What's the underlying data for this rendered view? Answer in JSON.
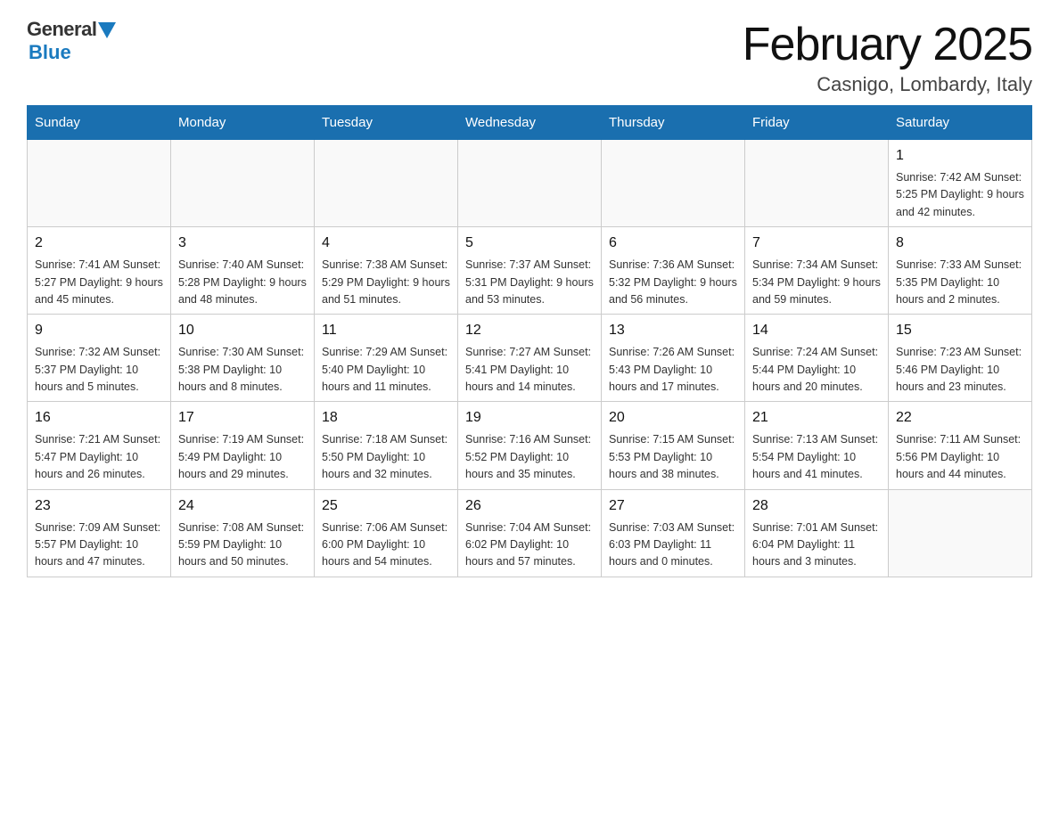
{
  "header": {
    "logo": {
      "general": "General",
      "blue": "Blue"
    },
    "title": "February 2025",
    "location": "Casnigo, Lombardy, Italy"
  },
  "days_of_week": [
    "Sunday",
    "Monday",
    "Tuesday",
    "Wednesday",
    "Thursday",
    "Friday",
    "Saturday"
  ],
  "weeks": [
    [
      {
        "day": "",
        "info": ""
      },
      {
        "day": "",
        "info": ""
      },
      {
        "day": "",
        "info": ""
      },
      {
        "day": "",
        "info": ""
      },
      {
        "day": "",
        "info": ""
      },
      {
        "day": "",
        "info": ""
      },
      {
        "day": "1",
        "info": "Sunrise: 7:42 AM\nSunset: 5:25 PM\nDaylight: 9 hours\nand 42 minutes."
      }
    ],
    [
      {
        "day": "2",
        "info": "Sunrise: 7:41 AM\nSunset: 5:27 PM\nDaylight: 9 hours\nand 45 minutes."
      },
      {
        "day": "3",
        "info": "Sunrise: 7:40 AM\nSunset: 5:28 PM\nDaylight: 9 hours\nand 48 minutes."
      },
      {
        "day": "4",
        "info": "Sunrise: 7:38 AM\nSunset: 5:29 PM\nDaylight: 9 hours\nand 51 minutes."
      },
      {
        "day": "5",
        "info": "Sunrise: 7:37 AM\nSunset: 5:31 PM\nDaylight: 9 hours\nand 53 minutes."
      },
      {
        "day": "6",
        "info": "Sunrise: 7:36 AM\nSunset: 5:32 PM\nDaylight: 9 hours\nand 56 minutes."
      },
      {
        "day": "7",
        "info": "Sunrise: 7:34 AM\nSunset: 5:34 PM\nDaylight: 9 hours\nand 59 minutes."
      },
      {
        "day": "8",
        "info": "Sunrise: 7:33 AM\nSunset: 5:35 PM\nDaylight: 10 hours\nand 2 minutes."
      }
    ],
    [
      {
        "day": "9",
        "info": "Sunrise: 7:32 AM\nSunset: 5:37 PM\nDaylight: 10 hours\nand 5 minutes."
      },
      {
        "day": "10",
        "info": "Sunrise: 7:30 AM\nSunset: 5:38 PM\nDaylight: 10 hours\nand 8 minutes."
      },
      {
        "day": "11",
        "info": "Sunrise: 7:29 AM\nSunset: 5:40 PM\nDaylight: 10 hours\nand 11 minutes."
      },
      {
        "day": "12",
        "info": "Sunrise: 7:27 AM\nSunset: 5:41 PM\nDaylight: 10 hours\nand 14 minutes."
      },
      {
        "day": "13",
        "info": "Sunrise: 7:26 AM\nSunset: 5:43 PM\nDaylight: 10 hours\nand 17 minutes."
      },
      {
        "day": "14",
        "info": "Sunrise: 7:24 AM\nSunset: 5:44 PM\nDaylight: 10 hours\nand 20 minutes."
      },
      {
        "day": "15",
        "info": "Sunrise: 7:23 AM\nSunset: 5:46 PM\nDaylight: 10 hours\nand 23 minutes."
      }
    ],
    [
      {
        "day": "16",
        "info": "Sunrise: 7:21 AM\nSunset: 5:47 PM\nDaylight: 10 hours\nand 26 minutes."
      },
      {
        "day": "17",
        "info": "Sunrise: 7:19 AM\nSunset: 5:49 PM\nDaylight: 10 hours\nand 29 minutes."
      },
      {
        "day": "18",
        "info": "Sunrise: 7:18 AM\nSunset: 5:50 PM\nDaylight: 10 hours\nand 32 minutes."
      },
      {
        "day": "19",
        "info": "Sunrise: 7:16 AM\nSunset: 5:52 PM\nDaylight: 10 hours\nand 35 minutes."
      },
      {
        "day": "20",
        "info": "Sunrise: 7:15 AM\nSunset: 5:53 PM\nDaylight: 10 hours\nand 38 minutes."
      },
      {
        "day": "21",
        "info": "Sunrise: 7:13 AM\nSunset: 5:54 PM\nDaylight: 10 hours\nand 41 minutes."
      },
      {
        "day": "22",
        "info": "Sunrise: 7:11 AM\nSunset: 5:56 PM\nDaylight: 10 hours\nand 44 minutes."
      }
    ],
    [
      {
        "day": "23",
        "info": "Sunrise: 7:09 AM\nSunset: 5:57 PM\nDaylight: 10 hours\nand 47 minutes."
      },
      {
        "day": "24",
        "info": "Sunrise: 7:08 AM\nSunset: 5:59 PM\nDaylight: 10 hours\nand 50 minutes."
      },
      {
        "day": "25",
        "info": "Sunrise: 7:06 AM\nSunset: 6:00 PM\nDaylight: 10 hours\nand 54 minutes."
      },
      {
        "day": "26",
        "info": "Sunrise: 7:04 AM\nSunset: 6:02 PM\nDaylight: 10 hours\nand 57 minutes."
      },
      {
        "day": "27",
        "info": "Sunrise: 7:03 AM\nSunset: 6:03 PM\nDaylight: 11 hours\nand 0 minutes."
      },
      {
        "day": "28",
        "info": "Sunrise: 7:01 AM\nSunset: 6:04 PM\nDaylight: 11 hours\nand 3 minutes."
      },
      {
        "day": "",
        "info": ""
      }
    ]
  ]
}
